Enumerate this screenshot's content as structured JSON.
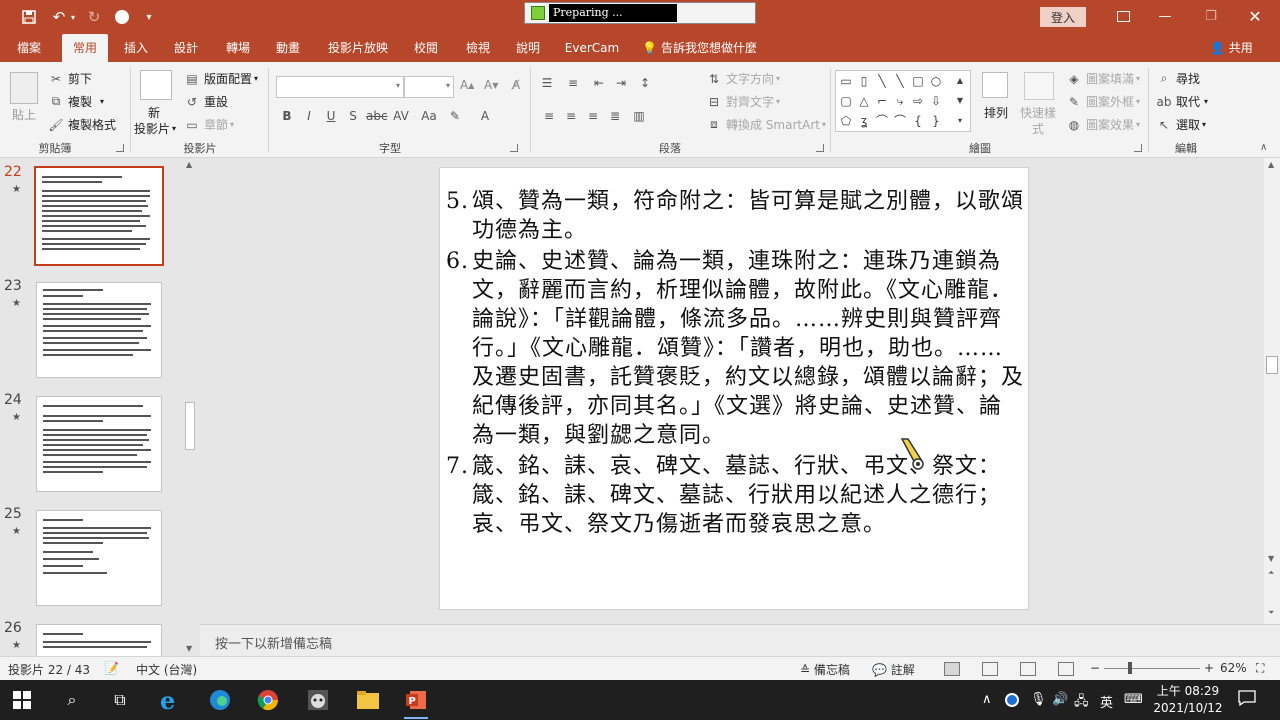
{
  "titlebar": {
    "progress_text": "Preparing ...",
    "signin_label": "登入"
  },
  "tabs": [
    {
      "label": "檔案"
    },
    {
      "label": "常用"
    },
    {
      "label": "插入"
    },
    {
      "label": "設計"
    },
    {
      "label": "轉場"
    },
    {
      "label": "動畫"
    },
    {
      "label": "投影片放映"
    },
    {
      "label": "校閱"
    },
    {
      "label": "檢視"
    },
    {
      "label": "說明"
    },
    {
      "label": "EverCam"
    }
  ],
  "tell_me": "告訴我您想做什麼",
  "share_label": "共用",
  "ribbon": {
    "paste": "貼上",
    "cut": "剪下",
    "copy": "複製",
    "format_painter": "複製格式",
    "clipboard_group": "剪貼簿",
    "new_slide_1": "新",
    "new_slide_2": "投影片",
    "layout": "版面配置",
    "reset": "重設",
    "section": "章節",
    "slides_group": "投影片",
    "font_group": "字型",
    "text_direction": "文字方向",
    "align_text": "對齊文字",
    "smartart": "轉換成 SmartArt",
    "paragraph_group": "段落",
    "arrange": "排列",
    "quick_styles_1": "快速樣",
    "quick_styles_2": "式",
    "shape_fill": "圖案填滿",
    "shape_outline": "圖案外框",
    "shape_effects": "圖案效果",
    "drawing_group": "繪圖",
    "find": "尋找",
    "replace": "取代",
    "select": "選取",
    "editing_group": "編輯"
  },
  "thumbnails": [
    {
      "num": "22",
      "star": "★"
    },
    {
      "num": "23",
      "star": "★"
    },
    {
      "num": "24",
      "star": "★"
    },
    {
      "num": "25",
      "star": "★"
    },
    {
      "num": "26",
      "star": "★"
    }
  ],
  "slide": {
    "items": [
      {
        "num": "5.",
        "text": "頌、贊為一類，符命附之：皆可算是賦之別體，以歌頌功德為主。"
      },
      {
        "num": "6.",
        "text": "史論、史述贊、論為一類，連珠附之：連珠乃連鎖為文，辭麗而言約，析理似論體，故附此。《文心雕龍．論說》：「詳觀論體，條流多品。……辨史則與贊評齊行。」《文心雕龍．頌贊》：「讚者，明也，助也。……及遷史固書，託贊褒貶，約文以總錄，頌體以論辭；及紀傳後評，亦同其名。」《文選》將史論、史述贊、論為一類，與劉勰之意同。"
      },
      {
        "num": "7.",
        "text": "箴、銘、誄、哀、碑文、墓誌、行狀、弔文、祭文：箴、銘、誄、碑文、墓誌、行狀用以紀述人之德行；哀、弔文、祭文乃傷逝者而發哀思之意。"
      }
    ]
  },
  "notes_placeholder": "按一下以新增備忘稿",
  "status": {
    "slide_count": "投影片 22 / 43",
    "language": "中文 (台灣)",
    "notes": "備忘稿",
    "comments": "註解",
    "zoom_minus": "−",
    "zoom_plus": "+",
    "zoom": "62%"
  },
  "taskbar": {
    "ime": "英",
    "time": "上午 08:29",
    "date": "2021/10/12"
  }
}
